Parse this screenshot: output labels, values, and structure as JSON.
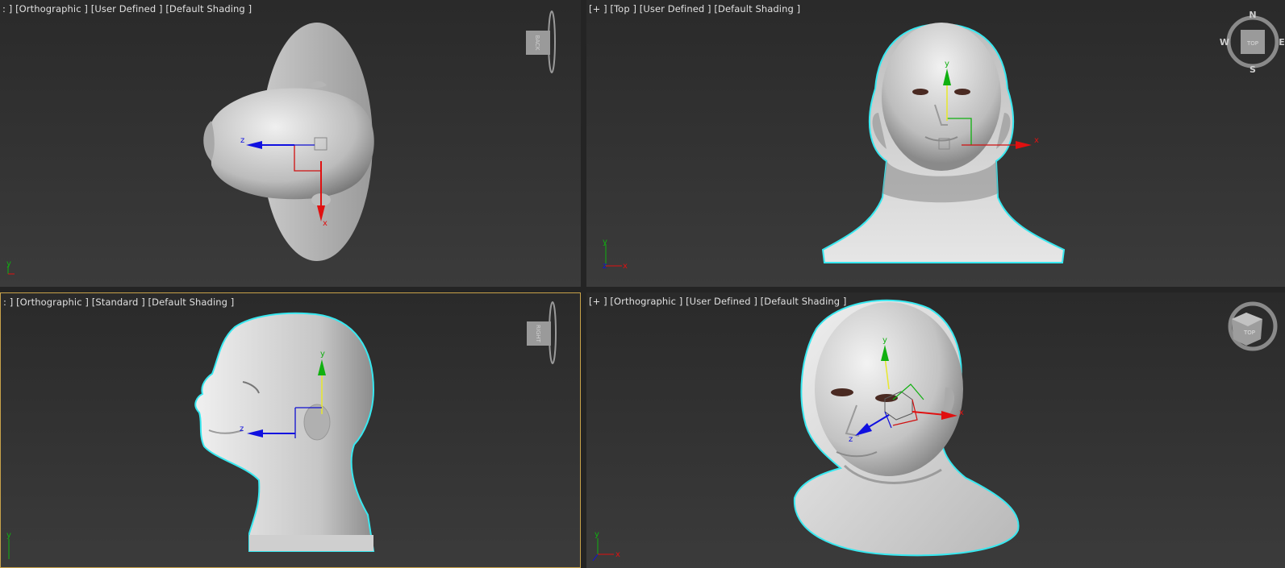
{
  "viewports": {
    "top_left": {
      "label": ": ] [Orthographic ] [User Defined ] [Default Shading ]",
      "cube_label": "BACK"
    },
    "top_right": {
      "label": "[+ ] [Top ] [User Defined ] [Default Shading ]",
      "cube_label": "TOP",
      "compass": {
        "n": "N",
        "s": "S",
        "e": "E",
        "w": "W"
      }
    },
    "bottom_left": {
      "label": ": ] [Orthographic ] [Standard ] [Default Shading ]",
      "cube_label": "RIGHT"
    },
    "bottom_right": {
      "label": "[+ ] [Orthographic ] [User Defined ] [Default Shading ]",
      "cube_label": "TOP"
    }
  },
  "gizmo_axes": {
    "x": "x",
    "y": "y",
    "z": "z"
  },
  "colors": {
    "selection_outline": "#38e8f0",
    "axis_x": "#e01010",
    "axis_y": "#10b010",
    "axis_z": "#1010e0",
    "active_viewport_border": "#c8a24a"
  },
  "icons": [
    "view-cube-icon",
    "compass-ring-icon",
    "move-gizmo-icon",
    "world-axis-tripod-icon"
  ]
}
